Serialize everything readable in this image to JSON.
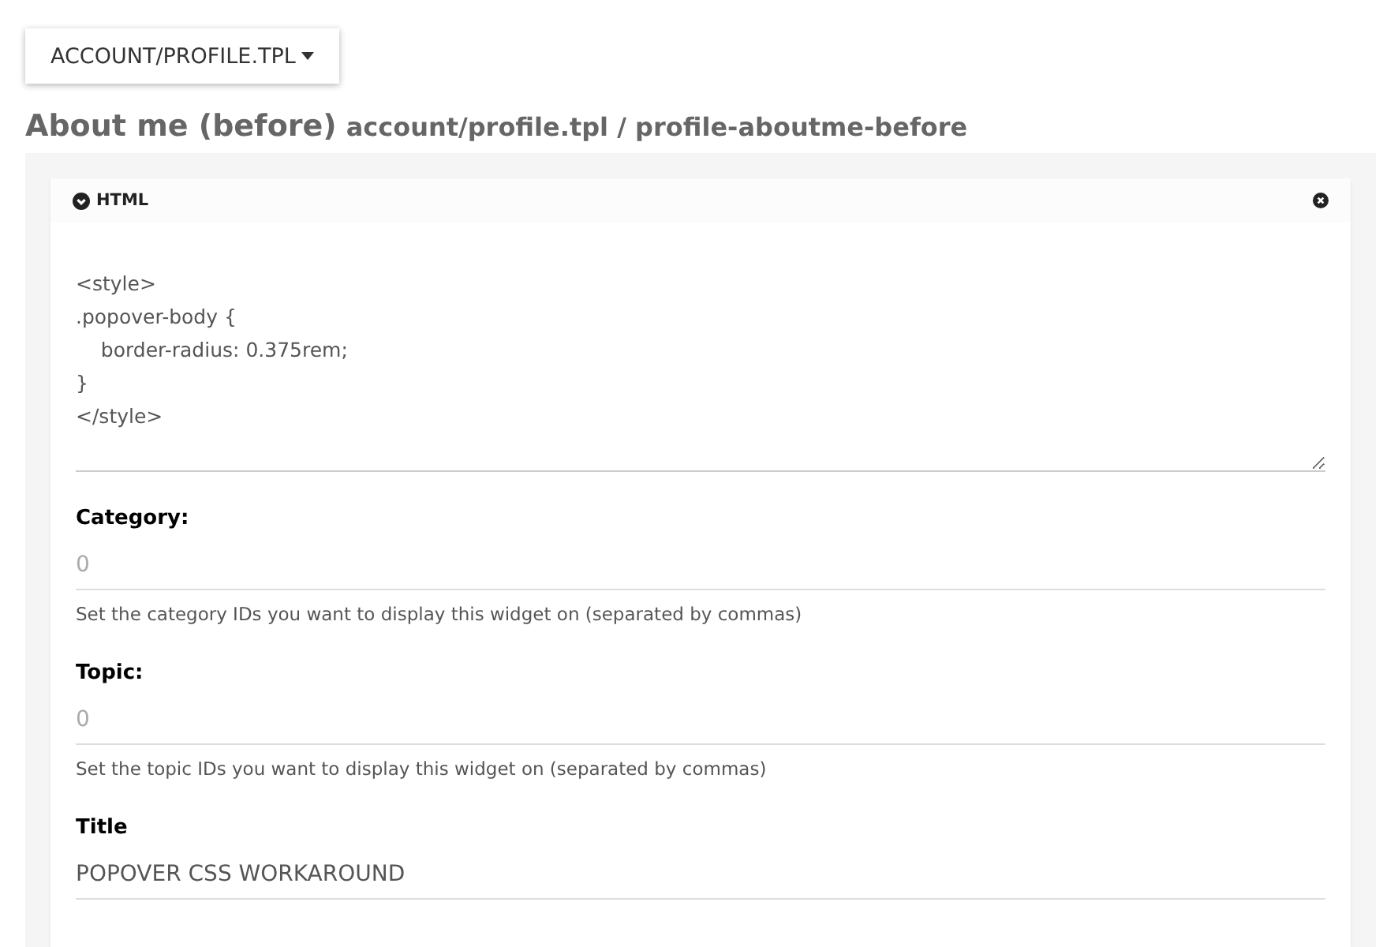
{
  "template_dropdown": {
    "label": "ACCOUNT/PROFILE.TPL"
  },
  "heading": {
    "title": "About me (before)",
    "subtitle": "account/profile.tpl / profile-aboutme-before"
  },
  "widget": {
    "title": "HTML",
    "expanded": true,
    "code": "<style>\n.popover-body {\n    border-radius: 0.375rem;\n}\n</style>",
    "fields": [
      {
        "label": "Category:",
        "placeholder": "0",
        "help": "Set the category IDs you want to display this widget on (separated by commas)"
      },
      {
        "label": "Topic:",
        "placeholder": "0",
        "help": "Set the topic IDs you want to display this widget on (separated by commas)"
      },
      {
        "label": "Title",
        "value": "POPOVER CSS WORKAROUND"
      }
    ]
  }
}
